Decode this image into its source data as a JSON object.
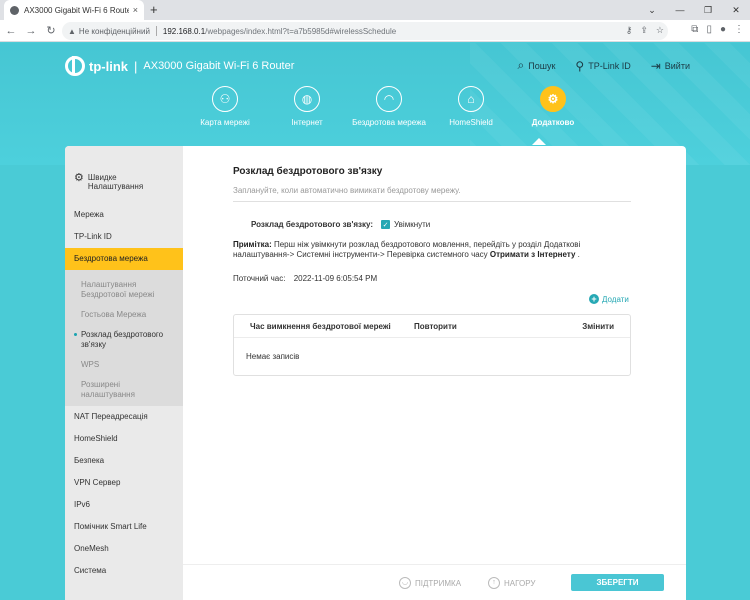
{
  "browser": {
    "tab_title": "AX3000 Gigabit Wi-Fi 6 Router",
    "tab_close": "×",
    "new_tab": "+",
    "security_label": "Не конфіденційний",
    "url_host": "192.168.0.1",
    "url_path": "/webpages/index.html?t=a7b5985d#wirelessSchedule"
  },
  "header": {
    "brand": "tp-link",
    "separator": "|",
    "model": "AX3000 Gigabit Wi-Fi 6 Router",
    "links": [
      {
        "label": "Пошук",
        "icon": "search-icon"
      },
      {
        "label": "TP-Link ID",
        "icon": "user-icon"
      },
      {
        "label": "Вийти",
        "icon": "logout-icon"
      }
    ]
  },
  "main_nav": [
    {
      "label": "Карта мережі",
      "icon": "network-map-icon"
    },
    {
      "label": "Інтернет",
      "icon": "globe-icon"
    },
    {
      "label": "Бездротова мережа",
      "icon": "wifi-icon"
    },
    {
      "label": "HomeShield",
      "icon": "shield-icon"
    },
    {
      "label": "Додатково",
      "icon": "gear-icon",
      "active": true
    }
  ],
  "sidebar": {
    "quick_setup": "Швидке Налаштування",
    "items_top": [
      "Мережа",
      "TP-Link ID"
    ],
    "active_item": "Бездротова мережа",
    "sub_items": [
      "Налаштування Бездротової мережі",
      "Гостьова Мережа",
      "Розклад бездротового зв'язку",
      "WPS",
      "Розширені налаштування"
    ],
    "current_sub": "Розклад бездротового зв'язку",
    "items_bottom": [
      "NAT Переадресація",
      "HomeShield",
      "Безпека",
      "VPN Сервер",
      "IPv6",
      "Помічник Smart Life",
      "OneMesh",
      "Система"
    ]
  },
  "content": {
    "title": "Розклад бездротового зв'язку",
    "description": "Заплануйте, коли автоматично вимикати бездротову мережу.",
    "toggle_label": "Розклад бездротового зв'язку:",
    "toggle_value": "Увімкнути",
    "note_label": "Примітка:",
    "note_text": " Перш ніж увімкнути розклад бездротового мовлення, перейдіть у розділ Додаткові налаштування-> Системні інструменти-> Перевірка системного часу ",
    "note_bold": "Отримати з Інтернету",
    "note_end": " .",
    "current_time_label": "Поточний час:",
    "current_time_value": "2022-11-09 6:05:54 PM",
    "add_label": "Додати",
    "table": {
      "headers": [
        "Час вимкнення бездротової мережі",
        "Повторити",
        "Змінити"
      ],
      "empty": "Немає записів"
    }
  },
  "footer": {
    "support": "ПІДТРИМКА",
    "top": "НАГОРУ",
    "save": "ЗБЕРЕГТИ"
  }
}
